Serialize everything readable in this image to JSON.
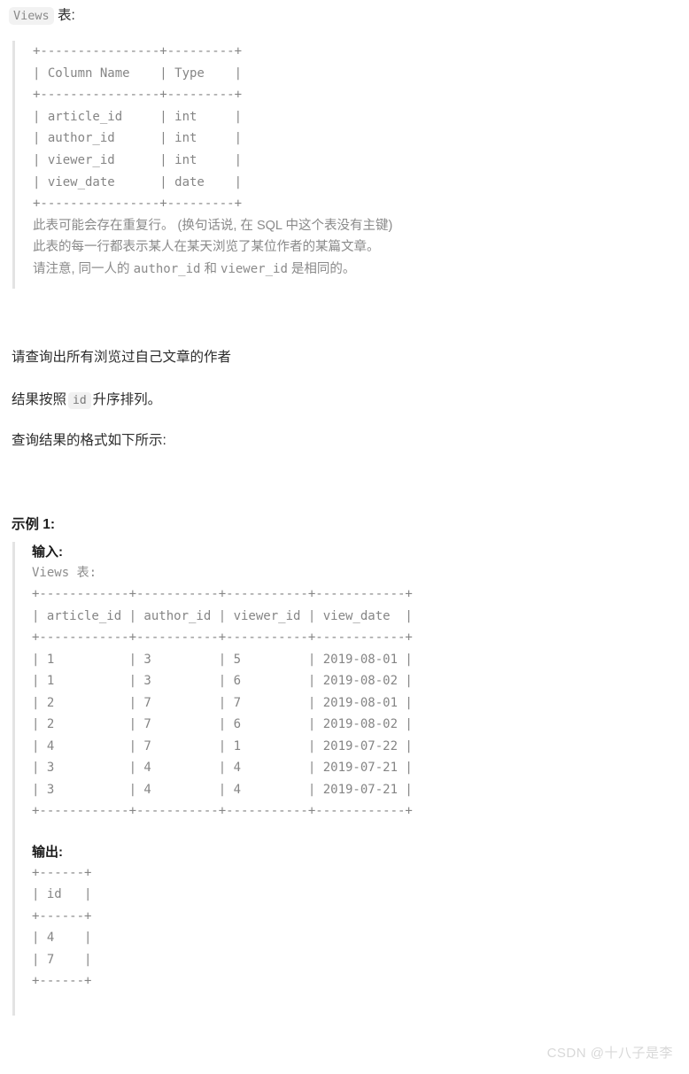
{
  "header": {
    "table_badge": "Views",
    "suffix": " 表:"
  },
  "schema_block": {
    "ascii_table": "+----------------+---------+\n| Column Name    | Type    |\n+----------------+---------+\n| article_id     | int     |\n| author_id      | int     |\n| viewer_id      | int     |\n| view_date      | date    |\n+----------------+---------+",
    "notes": [
      "此表可能会存在重复行。 (换句话说, 在 SQL 中这个表没有主键)",
      "此表的每一行都表示某人在某天浏览了某位作者的某篇文章。",
      "请注意, 同一人的 author_id 和 viewer_id 是相同的。"
    ],
    "note_line3_parts": {
      "a": "请注意, 同一人的 ",
      "code1": "author_id",
      "b": " 和 ",
      "code2": "viewer_id",
      "c": " 是相同的。"
    }
  },
  "body": {
    "requirement": "请查询出所有浏览过自己文章的作者",
    "order_prefix": "结果按照",
    "order_code": "id",
    "order_suffix": "升序排列。",
    "format_note": "查询结果的格式如下所示:"
  },
  "example": {
    "title": "示例 1:",
    "input_label": "输入:",
    "input_table_name": "Views 表:",
    "input_ascii": "+------------+-----------+-----------+------------+\n| article_id | author_id | viewer_id | view_date  |\n+------------+-----------+-----------+------------+\n| 1          | 3         | 5         | 2019-08-01 |\n| 1          | 3         | 6         | 2019-08-02 |\n| 2          | 7         | 7         | 2019-08-01 |\n| 2          | 7         | 6         | 2019-08-02 |\n| 4          | 7         | 1         | 2019-07-22 |\n| 3          | 4         | 4         | 2019-07-21 |\n| 3          | 4         | 4         | 2019-07-21 |\n+------------+-----------+-----------+------------+",
    "output_label": "输出:",
    "output_ascii": "+------+\n| id   |\n+------+\n| 4    |\n| 7    |\n+------+",
    "input_table": {
      "columns": [
        "article_id",
        "author_id",
        "viewer_id",
        "view_date"
      ],
      "rows": [
        [
          "1",
          "3",
          "5",
          "2019-08-01"
        ],
        [
          "1",
          "3",
          "6",
          "2019-08-02"
        ],
        [
          "2",
          "7",
          "7",
          "2019-08-01"
        ],
        [
          "2",
          "7",
          "6",
          "2019-08-02"
        ],
        [
          "4",
          "7",
          "1",
          "2019-07-22"
        ],
        [
          "3",
          "4",
          "4",
          "2019-07-21"
        ],
        [
          "3",
          "4",
          "4",
          "2019-07-21"
        ]
      ]
    },
    "output_table": {
      "columns": [
        "id"
      ],
      "rows": [
        [
          "4"
        ],
        [
          "7"
        ]
      ]
    },
    "schema_table": {
      "columns": [
        "Column Name",
        "Type"
      ],
      "rows": [
        [
          "article_id",
          "int"
        ],
        [
          "author_id",
          "int"
        ],
        [
          "viewer_id",
          "int"
        ],
        [
          "view_date",
          "date"
        ]
      ]
    }
  },
  "watermark": {
    "text": "CSDN @十八子是李"
  }
}
